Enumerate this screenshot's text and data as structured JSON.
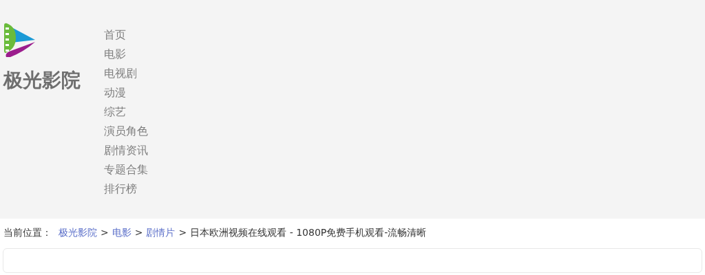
{
  "site": {
    "title": "极光影院"
  },
  "nav": [
    {
      "label": "首页"
    },
    {
      "label": "电影"
    },
    {
      "label": "电视剧"
    },
    {
      "label": "动漫"
    },
    {
      "label": "综艺"
    },
    {
      "label": "演员角色"
    },
    {
      "label": "剧情资讯"
    },
    {
      "label": "专题合集"
    },
    {
      "label": "排行榜"
    }
  ],
  "breadcrumb": {
    "prefix": "当前位置：",
    "separator": ">",
    "links": [
      "极光影院",
      "电影",
      "剧情片"
    ],
    "current": "日本欧洲视频在线观看 - 1080P免费手机观看-流畅清晰"
  }
}
